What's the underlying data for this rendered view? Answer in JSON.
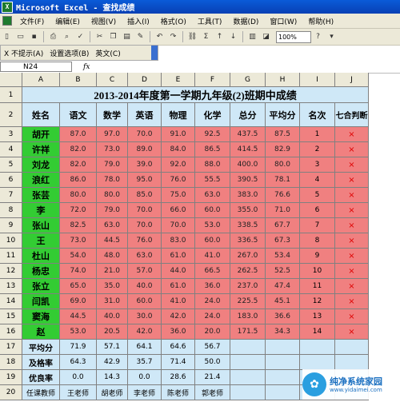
{
  "window": {
    "title": "Microsoft Excel - 查找成绩"
  },
  "menu": [
    "文件(F)",
    "编辑(E)",
    "视图(V)",
    "插入(I)",
    "格式(O)",
    "工具(T)",
    "数据(D)",
    "窗口(W)",
    "帮助(H)"
  ],
  "toolbar": {
    "zoom": "100%"
  },
  "langbar": {
    "items": [
      "X 不提示(A)",
      "设置选项(B)",
      "英文(C)"
    ]
  },
  "formula": {
    "namebox": "N24",
    "fx": "fx"
  },
  "columns": [
    "A",
    "B",
    "C",
    "D",
    "E",
    "F",
    "G",
    "H",
    "I",
    "J"
  ],
  "sheet": {
    "title": "2013-2014年度第一学期九年级(2)班期中成绩",
    "headers": [
      "姓名",
      "语文",
      "数学",
      "英语",
      "物理",
      "化学",
      "总分",
      "平均分",
      "名次",
      "七合判断"
    ],
    "students": [
      [
        "胡开",
        "87.0",
        "97.0",
        "70.0",
        "91.0",
        "92.5",
        "437.5",
        "87.5",
        "1",
        "×"
      ],
      [
        "许祥",
        "82.0",
        "73.0",
        "89.0",
        "84.0",
        "86.5",
        "414.5",
        "82.9",
        "2",
        "×"
      ],
      [
        "刘龙",
        "82.0",
        "79.0",
        "39.0",
        "92.0",
        "88.0",
        "400.0",
        "80.0",
        "3",
        "×"
      ],
      [
        "浪红",
        "86.0",
        "78.0",
        "95.0",
        "76.0",
        "55.5",
        "390.5",
        "78.1",
        "4",
        "×"
      ],
      [
        "张芸",
        "80.0",
        "80.0",
        "85.0",
        "75.0",
        "63.0",
        "383.0",
        "76.6",
        "5",
        "×"
      ],
      [
        "李",
        "72.0",
        "79.0",
        "70.0",
        "66.0",
        "60.0",
        "355.0",
        "71.0",
        "6",
        "×"
      ],
      [
        "张山",
        "82.5",
        "63.0",
        "70.0",
        "70.0",
        "53.0",
        "338.5",
        "67.7",
        "7",
        "×"
      ],
      [
        "王",
        "73.0",
        "44.5",
        "76.0",
        "83.0",
        "60.0",
        "336.5",
        "67.3",
        "8",
        "×"
      ],
      [
        "杜山",
        "54.0",
        "48.0",
        "63.0",
        "61.0",
        "41.0",
        "267.0",
        "53.4",
        "9",
        "×"
      ],
      [
        "杨忠",
        "74.0",
        "21.0",
        "57.0",
        "44.0",
        "66.5",
        "262.5",
        "52.5",
        "10",
        "×"
      ],
      [
        "张立",
        "65.0",
        "35.0",
        "40.0",
        "61.0",
        "36.0",
        "237.0",
        "47.4",
        "11",
        "×"
      ],
      [
        "闫凯",
        "69.0",
        "31.0",
        "60.0",
        "41.0",
        "24.0",
        "225.5",
        "45.1",
        "12",
        "×"
      ],
      [
        "窦海",
        "44.5",
        "40.0",
        "30.0",
        "42.0",
        "24.0",
        "183.0",
        "36.6",
        "13",
        "×"
      ],
      [
        "赵",
        "53.0",
        "20.5",
        "42.0",
        "36.0",
        "20.0",
        "171.5",
        "34.3",
        "14",
        "×"
      ]
    ],
    "stats": [
      {
        "label": "平均分",
        "values": [
          "71.9",
          "57.1",
          "64.1",
          "64.6",
          "56.7"
        ]
      },
      {
        "label": "及格率",
        "values": [
          "64.3",
          "42.9",
          "35.7",
          "71.4",
          "50.0"
        ]
      },
      {
        "label": "优良率",
        "values": [
          "0.0",
          "14.3",
          "0.0",
          "28.6",
          "21.4"
        ]
      }
    ],
    "teachers": {
      "label": "任课教师",
      "values": [
        "王老师",
        "胡老师",
        "李老师",
        "陈老师",
        "郭老师"
      ]
    }
  },
  "watermark": {
    "text": "纯净系统家园",
    "url": "www.yidaimei.com"
  }
}
